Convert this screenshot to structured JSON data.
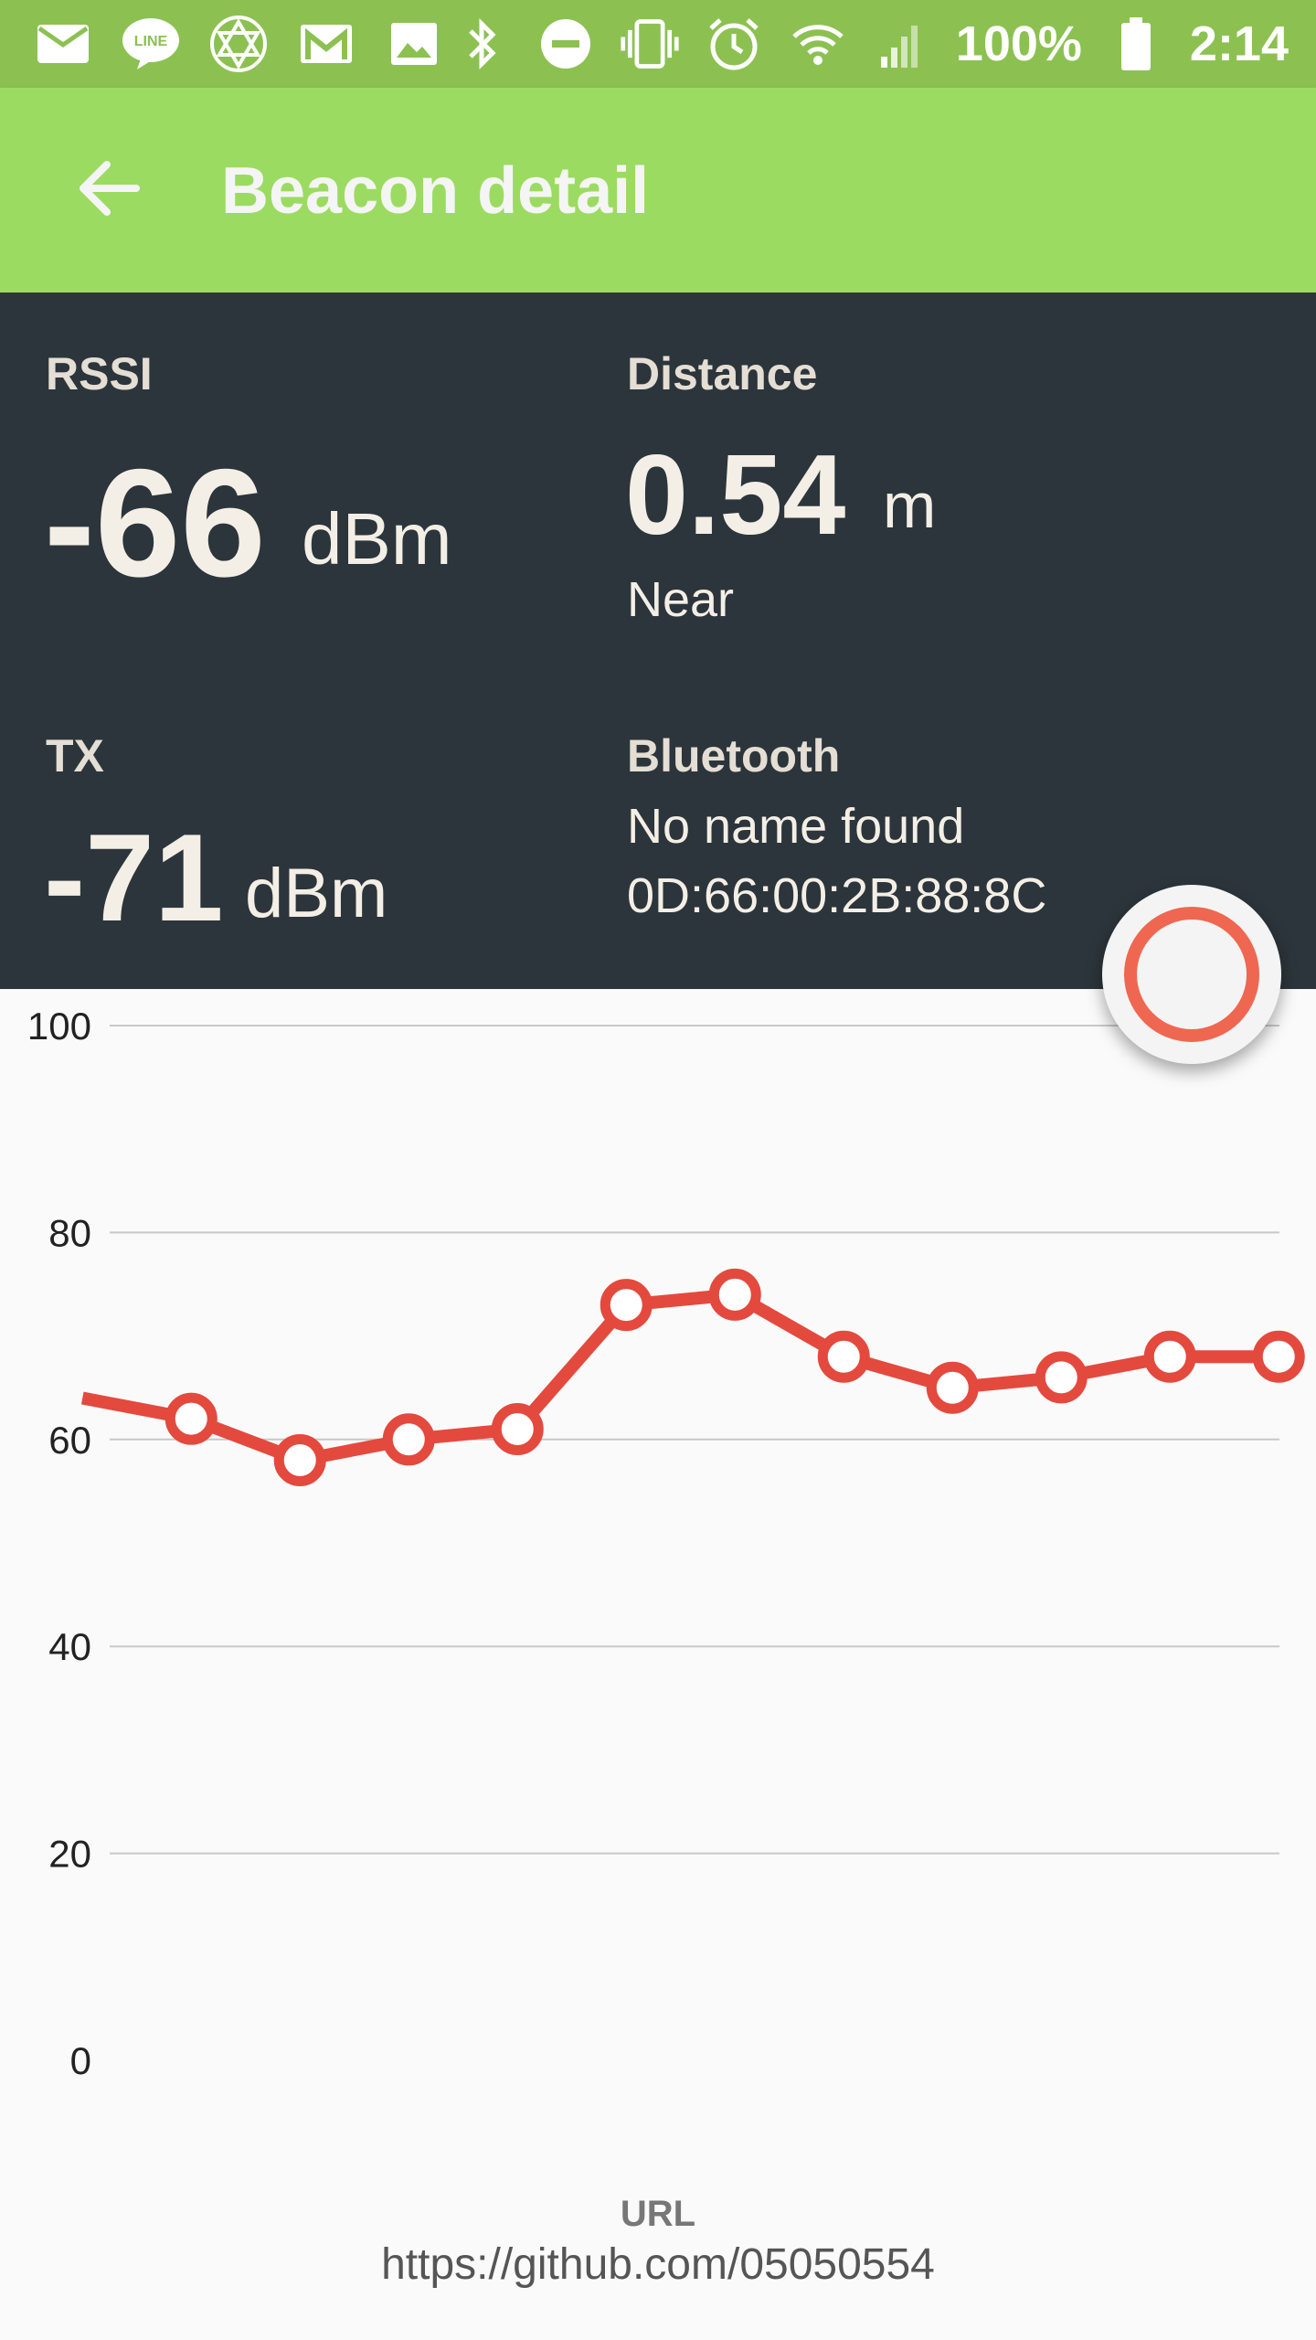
{
  "status_bar": {
    "left_icons": [
      "mail-icon",
      "line-app-icon",
      "star-of-david-icon",
      "gmail-icon",
      "image-icon"
    ],
    "right_icons": [
      "bluetooth-icon",
      "do-not-disturb-icon",
      "vibrate-icon",
      "alarm-icon",
      "wifi-icon",
      "signal-icon"
    ],
    "battery": "100%",
    "time": "2:14"
  },
  "app_bar": {
    "title": "Beacon detail",
    "back_icon": "arrow-back-icon"
  },
  "rssi": {
    "label": "RSSI",
    "value": "-66",
    "unit": "dBm"
  },
  "distance": {
    "label": "Distance",
    "value": "0.54",
    "unit": "m",
    "proximity": "Near"
  },
  "tx": {
    "label": "TX",
    "value": "-71",
    "unit": "dBm"
  },
  "bluetooth": {
    "label": "Bluetooth",
    "name": "No name found",
    "address": "0D:66:00:2B:88:8C"
  },
  "fab_icon": "record-circle-icon",
  "colors": {
    "status_bar": "#8cc152",
    "app_bar": "#9cdb62",
    "panel": "#2c353b",
    "line": "#e4493e",
    "fab_ring": "#ef6750"
  },
  "chart_data": {
    "type": "line",
    "y_ticks": [
      "100",
      "80",
      "60",
      "40",
      "20",
      "0"
    ],
    "ylim": [
      0,
      100
    ],
    "x": [
      0,
      1,
      2,
      3,
      4,
      5,
      6,
      7,
      8,
      9,
      10,
      11
    ],
    "values": [
      64,
      62,
      58,
      60,
      61,
      73,
      74,
      68,
      65,
      66,
      68,
      68
    ],
    "markers_from_index": 1,
    "grid": true,
    "legend": "none"
  },
  "footer": {
    "label": "URL",
    "url": "https://github.com/05050554"
  }
}
